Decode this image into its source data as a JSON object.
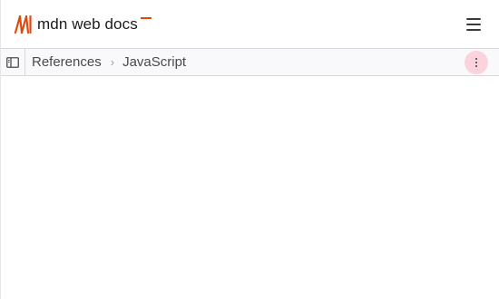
{
  "header": {
    "logo_text": "mdn web docs",
    "logo_icon": "mdn-logo-icon",
    "menu_icon": "hamburger-menu-icon",
    "accent_color": "#e04a0d"
  },
  "breadcrumb": {
    "sidebar_toggle_icon": "sidebar-toggle-icon",
    "items": [
      {
        "label": "References"
      },
      {
        "label": "JavaScript"
      }
    ],
    "separator": "›",
    "more_icon": "more-vertical-icon",
    "more_button_bg": "#fbd3dd"
  }
}
